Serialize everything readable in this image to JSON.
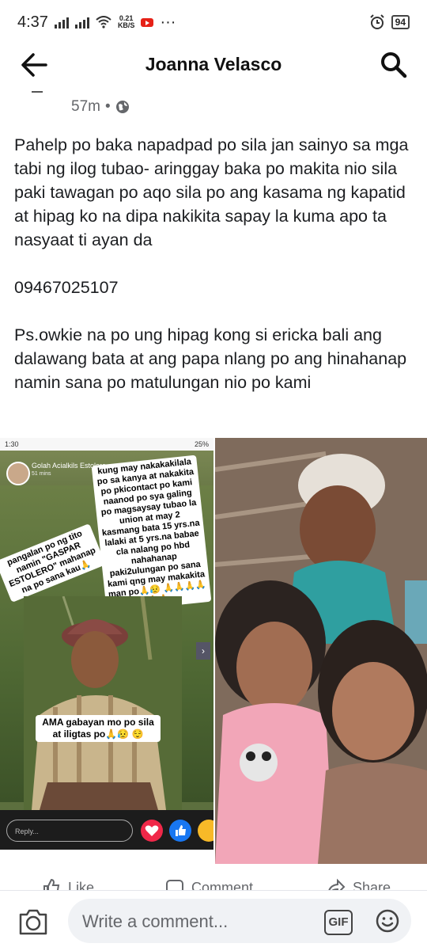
{
  "status_bar": {
    "time": "4:37",
    "net_speed_value": "0.21",
    "net_speed_unit": "KB/S",
    "more": "···",
    "battery": "94"
  },
  "app_bar": {
    "title": "Joanna Velasco"
  },
  "post": {
    "time": "57m",
    "separator": "•",
    "text": "Pahelp po baka napadpad po sila jan sainyo sa mga tabi ng ilog tubao- aringgay baka po makita nio sila paki tawagan po aqo sila po ang kasama ng kapatid at hipag ko na dipa nakikita sapay la kuma apo ta nasyaat ti ayan da\n\n09467025107\n\nPs.owkie na po ung hipag kong si ericka bali ang dalawang bata at ang papa nlang po ang hinahanap namin sana po matulungan nio po kami"
  },
  "image_left": {
    "status_time": "1:30",
    "status_battery": "25%",
    "author": "Golah Acialkils Estolero",
    "mins": "51 mins",
    "sticker_right": "kung may nakakakilala po sa kanya at nakakita po pkicontact po kami naanod po sya galing po magsaysay tubao la union at may 2 kasmang bata 15 yrs.na lalaki at 5 yrs.na babae cla nalang po hbd nahahanap paki2ulungan po sana kami qng may makakita man po🙏😥 🙏🙏🙏🙏🙏🙏",
    "sticker_left": "pangalan po ng tito namin \"GASPAR ESTOLERO\" mahanap na po sana kau🙏",
    "sticker_bottom": "AMA gabayan mo po sila at iligtas po🙏😥 😌",
    "reply_placeholder": "Reply..."
  },
  "actions": {
    "like": "Like",
    "comment": "Comment",
    "share": "Share"
  },
  "composer": {
    "placeholder": "Write a comment...",
    "gif": "GIF"
  }
}
